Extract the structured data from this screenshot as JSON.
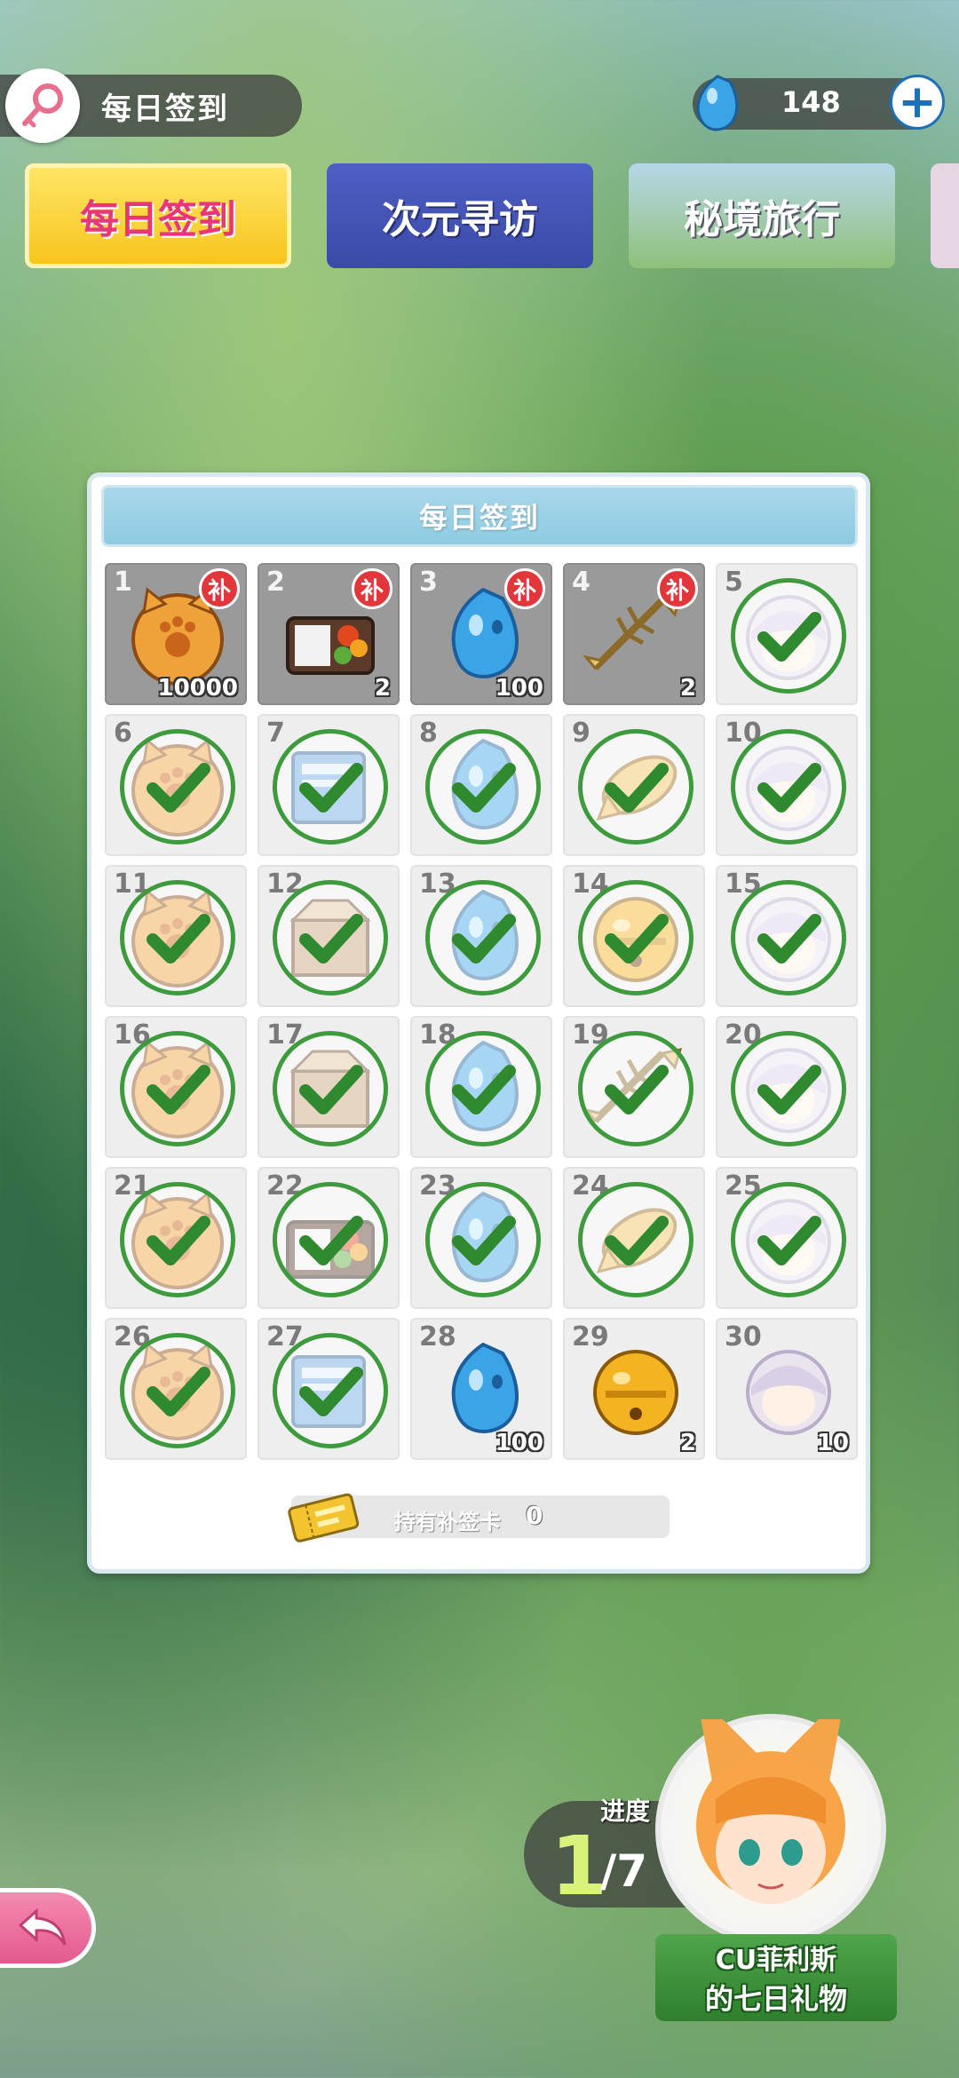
{
  "header": {
    "title": "每日签到",
    "title_icon": "key-icon",
    "currency_icon": "gem-icon",
    "currency_value": "148",
    "add_button": "+"
  },
  "tabs": [
    {
      "label": "每日签到",
      "selected": true
    },
    {
      "label": "次元寻访",
      "selected": false
    },
    {
      "label": "秘境旅行",
      "selected": false
    },
    {
      "label": "",
      "selected": false
    }
  ],
  "panel": {
    "title": "每日签到",
    "makeup_badge": "补",
    "days": [
      {
        "day": "1",
        "item": "coin",
        "qty": "10000",
        "state": "makeup"
      },
      {
        "day": "2",
        "item": "bento",
        "qty": "2",
        "state": "makeup"
      },
      {
        "day": "3",
        "item": "gem",
        "qty": "100",
        "state": "makeup"
      },
      {
        "day": "4",
        "item": "fishbone",
        "qty": "2",
        "state": "makeup"
      },
      {
        "day": "5",
        "item": "avatar",
        "qty": "",
        "state": "claimed"
      },
      {
        "day": "6",
        "item": "coin",
        "qty": "",
        "state": "claimed"
      },
      {
        "day": "7",
        "item": "book",
        "qty": "",
        "state": "claimed"
      },
      {
        "day": "8",
        "item": "gem",
        "qty": "",
        "state": "claimed"
      },
      {
        "day": "9",
        "item": "fish",
        "qty": "",
        "state": "claimed"
      },
      {
        "day": "10",
        "item": "avatar",
        "qty": "",
        "state": "claimed"
      },
      {
        "day": "11",
        "item": "coin",
        "qty": "",
        "state": "claimed"
      },
      {
        "day": "12",
        "item": "box",
        "qty": "",
        "state": "claimed"
      },
      {
        "day": "13",
        "item": "gem",
        "qty": "",
        "state": "claimed"
      },
      {
        "day": "14",
        "item": "bell",
        "qty": "",
        "state": "claimed"
      },
      {
        "day": "15",
        "item": "avatar",
        "qty": "",
        "state": "claimed"
      },
      {
        "day": "16",
        "item": "coin",
        "qty": "",
        "state": "claimed"
      },
      {
        "day": "17",
        "item": "box",
        "qty": "",
        "state": "claimed"
      },
      {
        "day": "18",
        "item": "gem",
        "qty": "",
        "state": "claimed"
      },
      {
        "day": "19",
        "item": "fishbone",
        "qty": "",
        "state": "claimed"
      },
      {
        "day": "20",
        "item": "avatar",
        "qty": "",
        "state": "claimed"
      },
      {
        "day": "21",
        "item": "coin",
        "qty": "",
        "state": "claimed"
      },
      {
        "day": "22",
        "item": "bento",
        "qty": "",
        "state": "claimed"
      },
      {
        "day": "23",
        "item": "gem",
        "qty": "",
        "state": "claimed"
      },
      {
        "day": "24",
        "item": "fish",
        "qty": "",
        "state": "claimed"
      },
      {
        "day": "25",
        "item": "avatar",
        "qty": "",
        "state": "claimed"
      },
      {
        "day": "26",
        "item": "coin",
        "qty": "",
        "state": "claimed"
      },
      {
        "day": "27",
        "item": "book",
        "qty": "",
        "state": "claimed"
      },
      {
        "day": "28",
        "item": "gem",
        "qty": "100",
        "state": "open"
      },
      {
        "day": "29",
        "item": "bell",
        "qty": "2",
        "state": "open"
      },
      {
        "day": "30",
        "item": "avatar",
        "qty": "10",
        "state": "open"
      }
    ],
    "card_label": "持有补签卡",
    "card_count": "0"
  },
  "progress": {
    "label": "进度",
    "current": "1",
    "total": "/7"
  },
  "gift": {
    "line1": "CU菲利斯",
    "line2": "的七日礼物"
  },
  "colors": {
    "check_green": "#3d9b3d",
    "badge_red": "#e2363b",
    "header_blue": "#8ecbe2"
  }
}
